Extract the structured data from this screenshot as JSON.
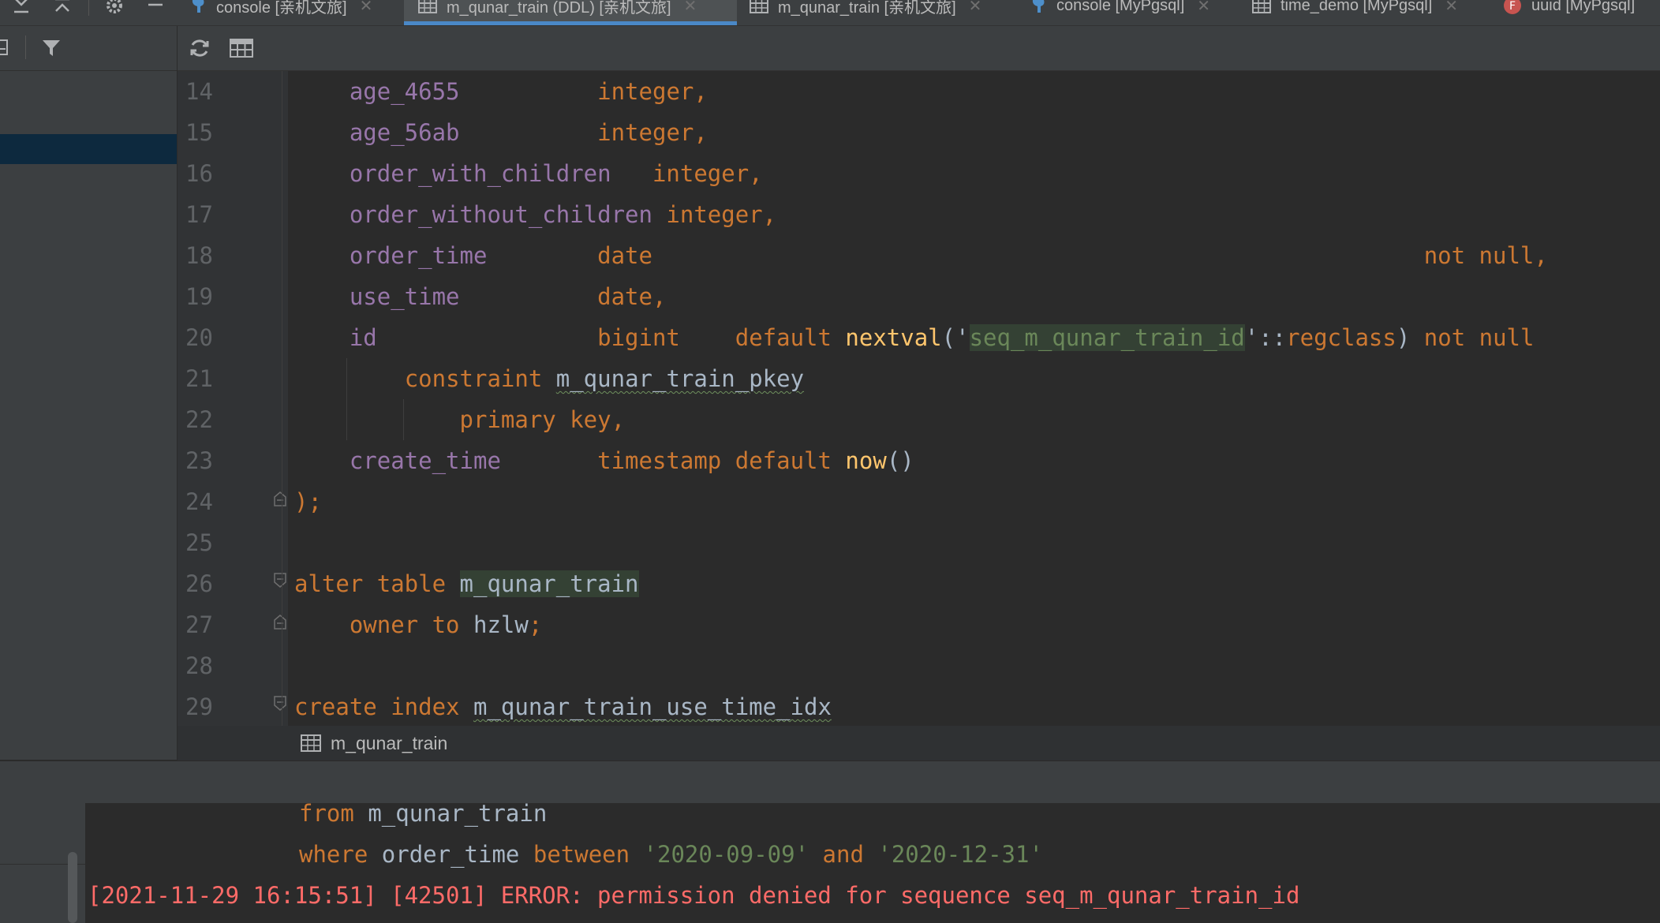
{
  "tabs": [
    {
      "label": "console [亲机文旅]",
      "icon": "postgres-elephant-icon",
      "active": false
    },
    {
      "label": "m_qunar_train (DDL) [亲机文旅]",
      "icon": "table-icon",
      "active": true
    },
    {
      "label": "m_qunar_train [亲机文旅]",
      "icon": "table-icon",
      "active": false
    },
    {
      "label": "console [MyPgsql]",
      "icon": "postgres-elephant-icon",
      "active": false
    },
    {
      "label": "time_demo [MyPgsql]",
      "icon": "table-icon",
      "active": false
    },
    {
      "label": "uuid [MyPgsql]",
      "icon": "function-icon",
      "active": false
    }
  ],
  "icons": {
    "tabbar_tools": [
      "expand-all-icon",
      "collapse-all-icon",
      "gear-icon",
      "minimize-icon"
    ],
    "left_toolbar": [
      "panel-icon",
      "filter-icon"
    ],
    "editor_toolbar": [
      "refresh-icon",
      "table-view-icon"
    ],
    "breadcrumb": "table-icon"
  },
  "editor": {
    "lines": [
      {
        "n": "14",
        "name": "age_4655",
        "type": "integer,"
      },
      {
        "n": "15",
        "name": "age_56ab",
        "type": "integer,"
      },
      {
        "n": "16",
        "name": "order_with_children",
        "type": "integer,"
      },
      {
        "n": "17",
        "name": "order_without_children",
        "type": "integer,"
      },
      {
        "n": "18",
        "name": "order_time",
        "type": "date",
        "tail": "not null,"
      },
      {
        "n": "19",
        "name": "use_time",
        "type": "date,"
      },
      {
        "n": "20",
        "name": "id",
        "type": "bigint",
        "kw_default": "default",
        "fn": "nextval",
        "paren_open": "('",
        "seq": "seq_m_qunar_train_id",
        "cast": "'::",
        "regclass": "regclass",
        "paren_close": ")",
        "tail": "not null"
      },
      {
        "n": "21",
        "kw": "constraint",
        "ident": "m_qunar_train_pkey"
      },
      {
        "n": "22",
        "kw": "primary key",
        "punct": ","
      },
      {
        "n": "23",
        "name": "create_time",
        "type": "timestamp",
        "kw_default": "default",
        "fn": "now",
        "punct": "()"
      },
      {
        "n": "24",
        "text": ");"
      },
      {
        "n": "25"
      },
      {
        "n": "26",
        "kw": "alter table",
        "ident": "m_qunar_train"
      },
      {
        "n": "27",
        "kw": "owner to",
        "ident": "hzlw",
        "punct": ";"
      },
      {
        "n": "28"
      },
      {
        "n": "29",
        "kw": "create index",
        "ident": "m_qunar_train_use_time_idx"
      }
    ]
  },
  "breadcrumb": {
    "label": "m_qunar_train"
  },
  "console": {
    "line1": {
      "kw": "from",
      "ident": "m_qunar_train"
    },
    "line2": {
      "kw_where": "where",
      "ident": "order_time",
      "kw_between": "between",
      "str1": "'2020-09-09'",
      "kw_and": "and",
      "str2": "'2020-12-31'"
    },
    "error": "[2021-11-29 16:15:51] [42501] ERROR: permission denied for sequence seq_m_qunar_train_id"
  },
  "colors": {
    "keyword": "#cc7832",
    "column": "#9876aa",
    "function": "#ffc66d",
    "string": "#6a8759",
    "error": "#ff6b68",
    "active_tab_underline": "#4a88c7"
  }
}
